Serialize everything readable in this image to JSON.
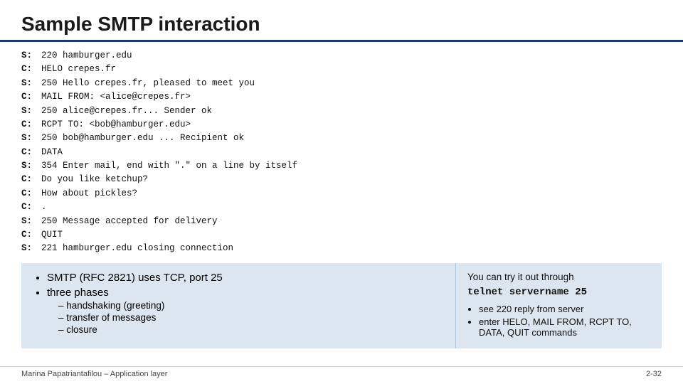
{
  "title": "Sample SMTP interaction",
  "smtp_lines": [
    {
      "label": "S:",
      "value": "220 hamburger.edu"
    },
    {
      "label": "C:",
      "value": "HELO crepes.fr"
    },
    {
      "label": "S:",
      "value": "250  Hello crepes.fr, pleased to meet you"
    },
    {
      "label": "C:",
      "value": "MAIL FROM: <alice@crepes.fr>"
    },
    {
      "label": "S:",
      "value": "250 alice@crepes.fr... Sender ok"
    },
    {
      "label": "C:",
      "value": "RCPT TO: <bob@hamburger.edu>"
    },
    {
      "label": "S:",
      "value": "250 bob@hamburger.edu ... Recipient ok"
    },
    {
      "label": "C:",
      "value": "DATA"
    },
    {
      "label": "S:",
      "value": "354 Enter mail, end with \".\" on a line by itself"
    },
    {
      "label": "C:",
      "value": "Do you like ketchup?"
    },
    {
      "label": "C:",
      "value": "How about pickles?"
    },
    {
      "label": "C:",
      "value": "."
    },
    {
      "label": "S:",
      "value": "250 Message accepted for delivery"
    },
    {
      "label": "C:",
      "value": "QUIT"
    },
    {
      "label": "S:",
      "value": "221 hamburger.edu closing connection"
    }
  ],
  "bullets": {
    "item1": "SMTP (RFC 2821) uses TCP, port 25",
    "item2": "three phases",
    "sub_items": [
      "handshaking (greeting)",
      "transfer of messages",
      "closure"
    ]
  },
  "telnet": {
    "intro": "You can try it out through",
    "command": "telnet servername 25",
    "tips": [
      "see 220 reply from server",
      "enter HELO, MAIL FROM, RCPT TO, DATA, QUIT commands"
    ]
  },
  "footer": {
    "left": "Marina Papatriantafilou –  Application layer",
    "right": "2-32"
  }
}
